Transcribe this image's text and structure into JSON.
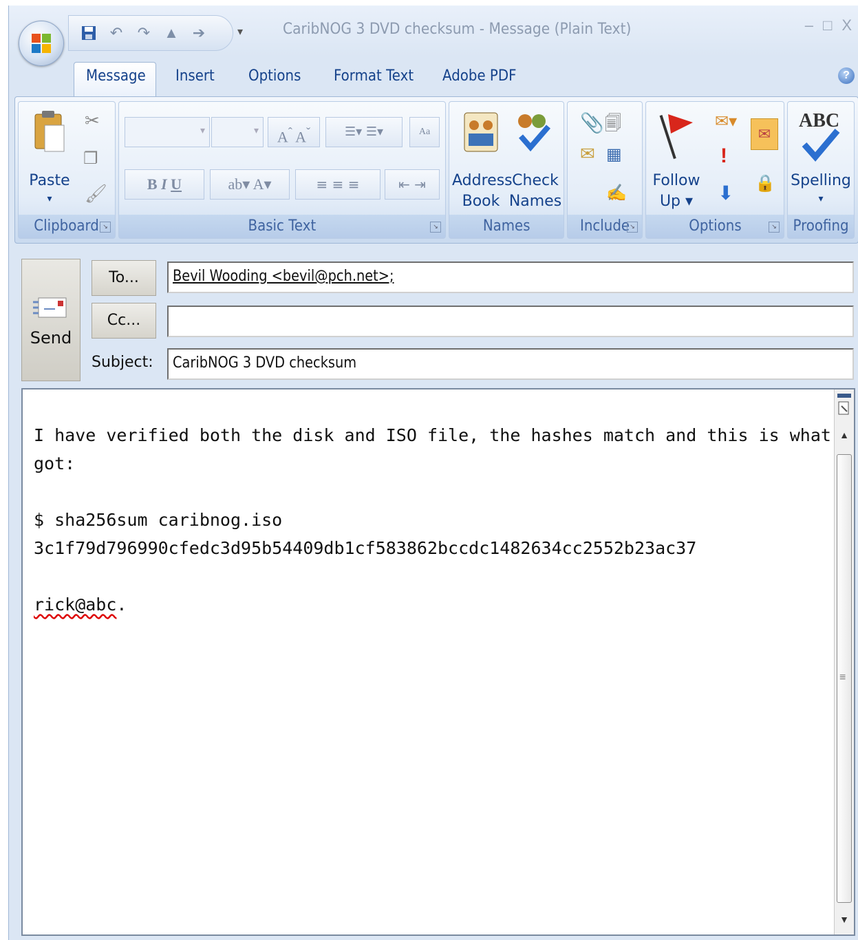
{
  "window": {
    "title": "CaribNOG 3 DVD checksum - Message (Plain Text)"
  },
  "tabs": [
    "Message",
    "Insert",
    "Options",
    "Format Text",
    "Adobe PDF"
  ],
  "ribbon": {
    "groups": {
      "clipboard": "Clipboard",
      "basic_text": "Basic Text",
      "names": "Names",
      "include": "Include",
      "options": "Options",
      "proofing": "Proofing"
    },
    "buttons": {
      "paste": "Paste",
      "address_book_1": "Address",
      "address_book_2": "Book",
      "check_names_1": "Check",
      "check_names_2": "Names",
      "follow_up_1": "Follow",
      "follow_up_2": "Up",
      "spelling": "Spelling",
      "spelling_icon_text": "ABC"
    }
  },
  "header": {
    "send_label": "Send",
    "to_label": "To...",
    "cc_label": "Cc...",
    "subject_label": "Subject:",
    "to_value": "Bevil Wooding <bevil@pch.net>;",
    "cc_value": "",
    "subject_value": "CaribNOG 3 DVD checksum"
  },
  "body": {
    "line1": "I have verified both the disk and ISO file, the hashes match and this is what I",
    "line2": "got:",
    "line3": "$ sha256sum caribnog.iso",
    "line4": "3c1f79d796990cfedc3d95b54409db1cf583862bccdc1482634cc2552b23ac37",
    "signature": "rick@abc",
    "signature_end": "."
  }
}
